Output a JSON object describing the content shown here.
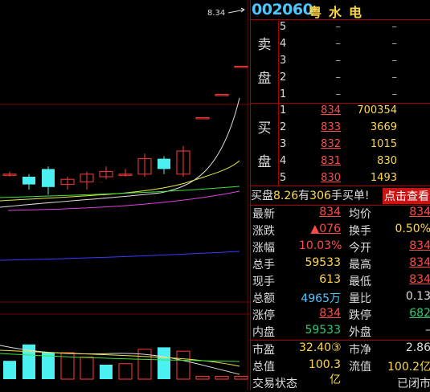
{
  "chart": {
    "price_label": "8.34",
    "candles": [
      {
        "o": 8.06,
        "c": 8.06,
        "h": 8.07,
        "l": 8.05,
        "color": "red"
      },
      {
        "o": 8.02,
        "c": 8.05,
        "h": 8.06,
        "l": 8.0,
        "color": "cyan"
      },
      {
        "o": 8.08,
        "c": 8.01,
        "h": 8.09,
        "l": 7.98,
        "color": "cyan"
      },
      {
        "o": 8.02,
        "c": 8.04,
        "h": 8.05,
        "l": 8.0,
        "color": "red"
      },
      {
        "o": 8.03,
        "c": 8.06,
        "h": 8.07,
        "l": 8.0,
        "color": "red"
      },
      {
        "o": 8.05,
        "c": 8.07,
        "h": 8.09,
        "l": 8.04,
        "color": "red"
      },
      {
        "o": 8.06,
        "c": 8.06,
        "h": 8.08,
        "l": 8.05,
        "color": "red"
      },
      {
        "o": 8.06,
        "c": 8.12,
        "h": 8.14,
        "l": 8.05,
        "color": "red"
      },
      {
        "o": 8.12,
        "c": 8.08,
        "h": 8.13,
        "l": 8.06,
        "color": "cyan"
      },
      {
        "o": 8.06,
        "c": 8.15,
        "h": 8.17,
        "l": 8.05,
        "color": "red"
      },
      {
        "o": 8.28,
        "c": 8.28,
        "h": 8.28,
        "l": 8.28,
        "color": "red"
      },
      {
        "o": 8.37,
        "c": 8.37,
        "h": 8.37,
        "l": 8.37,
        "color": "red"
      },
      {
        "o": 8.48,
        "c": 8.48,
        "h": 8.48,
        "l": 8.48,
        "color": "red"
      }
    ],
    "volumes": [
      {
        "v": 0.38,
        "color": "cyan"
      },
      {
        "v": 0.72,
        "color": "cyan"
      },
      {
        "v": 0.55,
        "color": "cyan"
      },
      {
        "v": 0.55,
        "color": "red"
      },
      {
        "v": 0.46,
        "color": "red"
      },
      {
        "v": 0.3,
        "color": "cyan"
      },
      {
        "v": 0.32,
        "color": "red"
      },
      {
        "v": 0.62,
        "color": "red"
      },
      {
        "v": 0.66,
        "color": "cyan"
      },
      {
        "v": 0.58,
        "color": "red"
      },
      {
        "v": 0.06,
        "color": "red"
      },
      {
        "v": 0.06,
        "color": "red"
      },
      {
        "v": 0.06,
        "color": "red"
      }
    ]
  },
  "header": {
    "code": "002060",
    "name": "粤水电"
  },
  "sell": {
    "side_top": "卖",
    "side_bottom": "盘",
    "rows": [
      {
        "n": "5",
        "p": "–",
        "v": "–"
      },
      {
        "n": "4",
        "p": "–",
        "v": "–"
      },
      {
        "n": "3",
        "p": "–",
        "v": "–"
      },
      {
        "n": "2",
        "p": "–",
        "v": "–"
      },
      {
        "n": "1",
        "p": "–",
        "v": "–"
      }
    ]
  },
  "buy": {
    "side_1": "买",
    "side_2": "盘",
    "rows": [
      {
        "n": "1",
        "p": "834",
        "v": "700354"
      },
      {
        "n": "2",
        "p": "833",
        "v": "3669"
      },
      {
        "n": "3",
        "p": "832",
        "v": "1015"
      },
      {
        "n": "4",
        "p": "831",
        "v": "830"
      },
      {
        "n": "5",
        "p": "830",
        "v": "1493"
      }
    ]
  },
  "order_bar": {
    "pre": "买盘",
    "price": "8.26",
    "mid": "有",
    "qty": "306",
    "post": "手买单!",
    "button": "点击查看"
  },
  "stats": [
    {
      "l1": "最新",
      "v1": "834",
      "c1": "red ul",
      "l2": "均价",
      "v2": "834",
      "c2": "red ul"
    },
    {
      "l1": "涨跌",
      "v1": "▲076",
      "c1": "red ul",
      "l2": "换手",
      "v2": "0.50%",
      "c2": "yel"
    },
    {
      "l1": "涨幅",
      "v1": "10.03%",
      "c1": "red",
      "l2": "今开",
      "v2": "834",
      "c2": "red ul"
    },
    {
      "l1": "总手",
      "v1": "59533",
      "c1": "yel",
      "l2": "最高",
      "v2": "834",
      "c2": "red ul"
    },
    {
      "l1": "现手",
      "v1": "613",
      "c1": "yel",
      "l2": "最低",
      "v2": "834",
      "c2": "red ul"
    },
    {
      "l1": "总额",
      "v1": "4965万",
      "c1": "cyan",
      "l2": "量比",
      "v2": "0.13",
      "c2": "wht"
    },
    {
      "l1": "涨停",
      "v1": "834",
      "c1": "red ul",
      "l2": "跌停",
      "v2": "682",
      "c2": "grn ul"
    },
    {
      "l1": "内盘",
      "v1": "59533",
      "c1": "grn",
      "l2": "外盘",
      "v2": "–",
      "c2": "wht"
    }
  ],
  "fund": [
    {
      "l1": "市盈",
      "v1": "32.40③",
      "c1": "yel",
      "l2": "市净",
      "v2": "2.86",
      "c2": "wht"
    },
    {
      "l1": "总值",
      "v1": "100.3亿",
      "c1": "yel",
      "l2": "流值",
      "v2": "100.2亿",
      "c2": "yel"
    },
    {
      "l1": "交易状态",
      "v1": "",
      "c1": "wht",
      "l2": "",
      "v2": "已闭市",
      "c2": "wht"
    }
  ]
}
